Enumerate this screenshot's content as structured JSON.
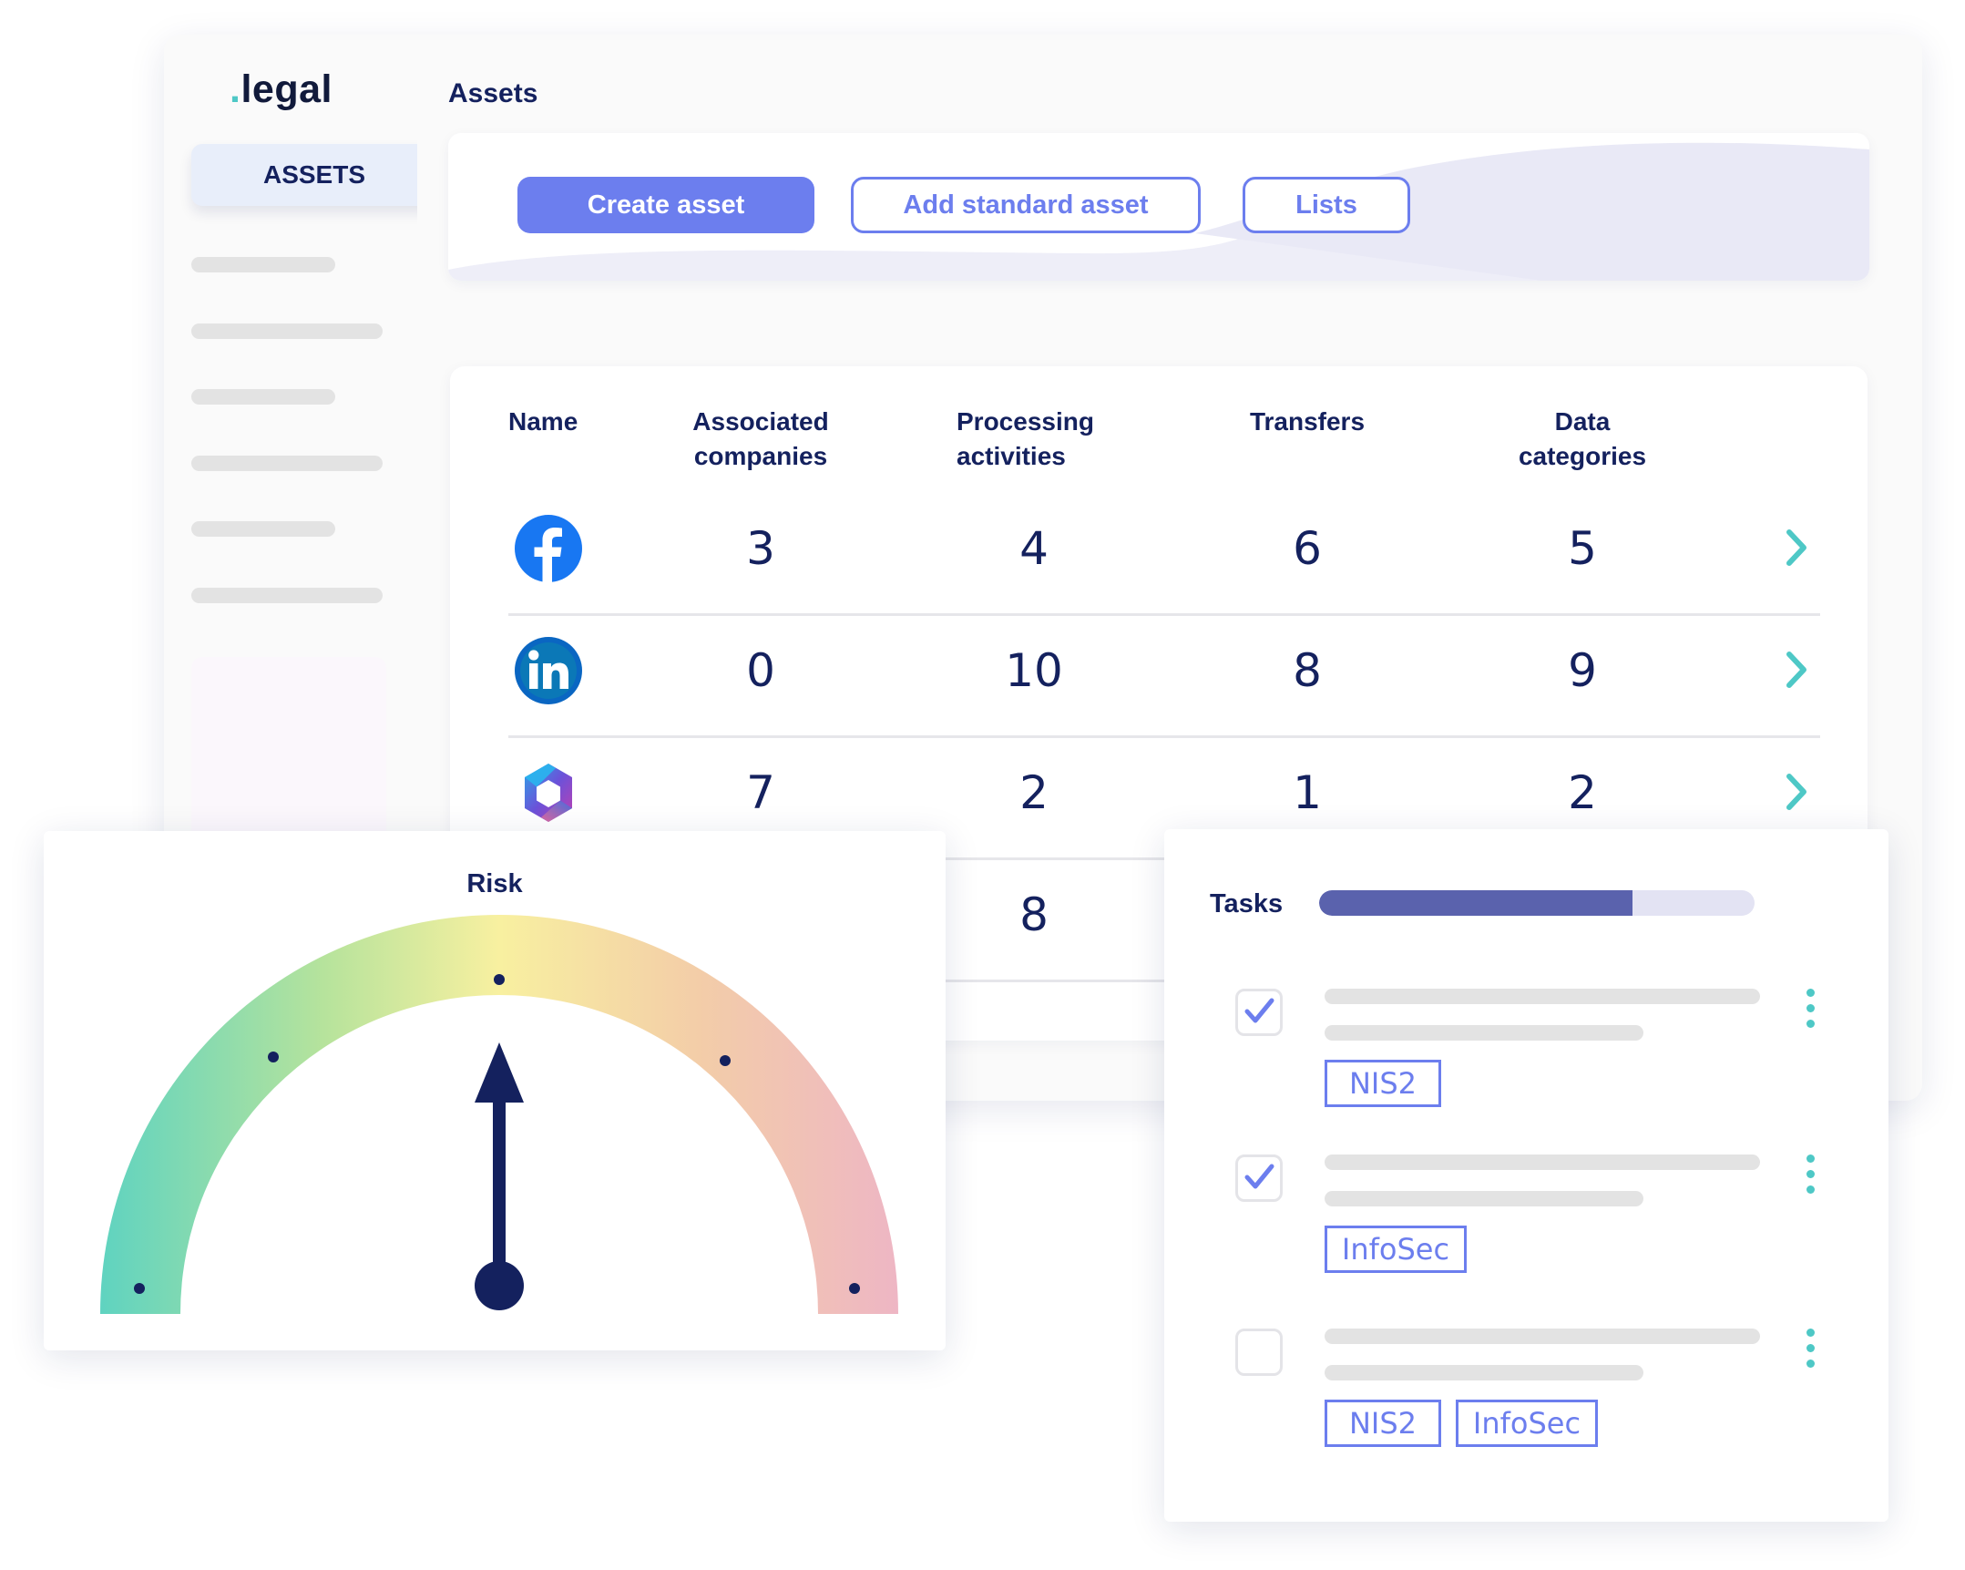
{
  "brand": {
    "logo_dot": ".",
    "logo_text": "legal"
  },
  "sidebar": {
    "active_item": "ASSETS"
  },
  "page": {
    "title": "Assets"
  },
  "toolbar": {
    "create_label": "Create asset",
    "standard_label": "Add standard asset",
    "lists_label": "Lists"
  },
  "table": {
    "headers": {
      "name": "Name",
      "associated_1": "Associated",
      "associated_2": "companies",
      "processing_1": "Processing",
      "processing_2": "activities",
      "transfers": "Transfers",
      "data_1": "Data",
      "data_2": "categories"
    },
    "rows": [
      {
        "logo": "facebook-logo",
        "associated": "3",
        "processing": "4",
        "transfers": "6",
        "data": "5"
      },
      {
        "logo": "linkedin-logo",
        "associated": "0",
        "processing": "10",
        "transfers": "8",
        "data": "9"
      },
      {
        "logo": "microsoft365-logo",
        "associated": "7",
        "processing": "2",
        "transfers": "1",
        "data": "2"
      },
      {
        "logo": "",
        "associated": "",
        "processing": "8",
        "transfers": "",
        "data": ""
      }
    ]
  },
  "risk": {
    "title": "Risk",
    "level_fraction": 0.5
  },
  "tasks": {
    "title": "Tasks",
    "progress_fraction": 0.72,
    "items": [
      {
        "checked": true,
        "tags": [
          "NIS2"
        ]
      },
      {
        "checked": true,
        "tags": [
          "InfoSec"
        ]
      },
      {
        "checked": false,
        "tags": [
          "NIS2",
          "InfoSec"
        ]
      }
    ]
  },
  "colors": {
    "accent": "#6c7eee",
    "navy": "#14215e",
    "teal": "#4ec8c6",
    "progress": "#5a62ad"
  }
}
